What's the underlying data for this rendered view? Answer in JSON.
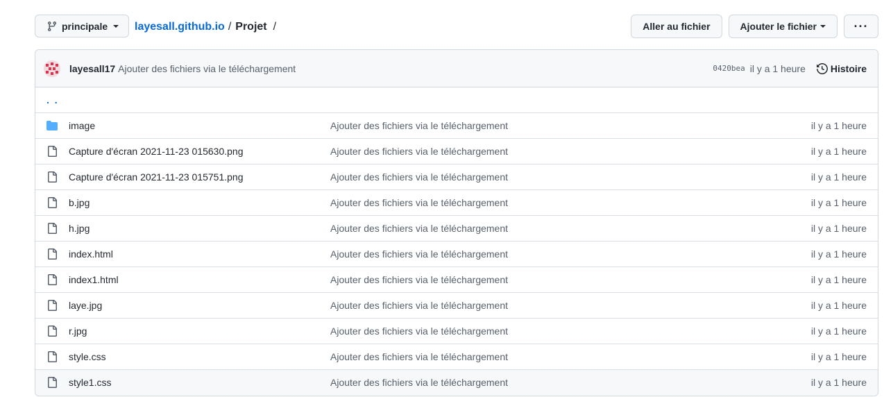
{
  "header": {
    "branch_label": "principale",
    "repo_name": "layesall.github.io",
    "separator": "/",
    "current_dir": "Projet",
    "go_to_file": "Aller au fichier",
    "add_file": "Ajouter le fichier",
    "more": "···"
  },
  "commit": {
    "author": "layesall17",
    "message": "Ajouter des fichiers via le téléchargement",
    "sha": "0420bea",
    "time": "il y a 1 heure",
    "history_label": "Histoire"
  },
  "parent_link": ". .",
  "files": [
    {
      "type": "folder",
      "name": "image",
      "message": "Ajouter des fichiers via le téléchargement",
      "time": "il y a 1 heure"
    },
    {
      "type": "file",
      "name": "Capture d'écran 2021-11-23 015630.png",
      "message": "Ajouter des fichiers via le téléchargement",
      "time": "il y a 1 heure"
    },
    {
      "type": "file",
      "name": "Capture d'écran 2021-11-23 015751.png",
      "message": "Ajouter des fichiers via le téléchargement",
      "time": "il y a 1 heure"
    },
    {
      "type": "file",
      "name": "b.jpg",
      "message": "Ajouter des fichiers via le téléchargement",
      "time": "il y a 1 heure"
    },
    {
      "type": "file",
      "name": "h.jpg",
      "message": "Ajouter des fichiers via le téléchargement",
      "time": "il y a 1 heure"
    },
    {
      "type": "file",
      "name": "index.html",
      "message": "Ajouter des fichiers via le téléchargement",
      "time": "il y a 1 heure"
    },
    {
      "type": "file",
      "name": "index1.html",
      "message": "Ajouter des fichiers via le téléchargement",
      "time": "il y a 1 heure"
    },
    {
      "type": "file",
      "name": "laye.jpg",
      "message": "Ajouter des fichiers via le téléchargement",
      "time": "il y a 1 heure"
    },
    {
      "type": "file",
      "name": "r.jpg",
      "message": "Ajouter des fichiers via le téléchargement",
      "time": "il y a 1 heure"
    },
    {
      "type": "file",
      "name": "style.css",
      "message": "Ajouter des fichiers via le téléchargement",
      "time": "il y a 1 heure"
    },
    {
      "type": "file",
      "name": "style1.css",
      "message": "Ajouter des fichiers via le téléchargement",
      "time": "il y a 1 heure"
    }
  ],
  "colors": {
    "link": "#0969da",
    "folder": "#54aeff",
    "muted": "#57606a"
  }
}
